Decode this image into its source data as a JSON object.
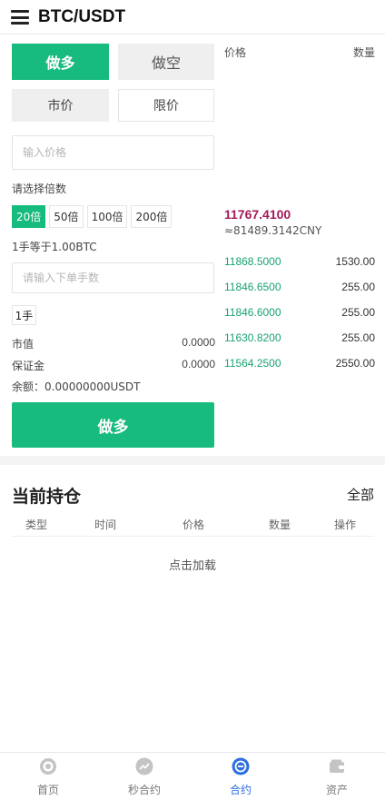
{
  "header": {
    "title": "BTC/USDT",
    "menu_icon": "hamburger-menu-icon"
  },
  "trade": {
    "long_tab": "做多",
    "short_tab": "做空",
    "market_tab": "市价",
    "limit_tab": "限价",
    "price_placeholder": "输入价格",
    "leverage_label": "请选择倍数",
    "leverages": [
      "20倍",
      "50倍",
      "100倍",
      "200倍"
    ],
    "leverage_selected": "20倍",
    "hand_info": "1手等于1.00BTC",
    "qty_placeholder": "请输入下单手数",
    "hand_unit": "1手",
    "market_value_label": "市值",
    "market_value": "0.0000",
    "margin_label": "保证金",
    "margin_value": "0.0000",
    "balance": "余额：0.00000000USDT",
    "submit_label": "做多"
  },
  "orderbook": {
    "price_header": "价格",
    "qty_header": "数量",
    "last_price": "11767.4100",
    "last_price_cny": "≈81489.3142CNY",
    "rows": [
      {
        "price": "11868.5000",
        "qty": "1530.00"
      },
      {
        "price": "11846.6500",
        "qty": "255.00"
      },
      {
        "price": "11846.6000",
        "qty": "255.00"
      },
      {
        "price": "11630.8200",
        "qty": "255.00"
      },
      {
        "price": "11564.2500",
        "qty": "2550.00"
      }
    ]
  },
  "positions": {
    "title": "当前持仓",
    "all_label": "全部",
    "columns": [
      "类型",
      "时间",
      "价格",
      "数量",
      "操作"
    ],
    "empty_text": "点击加载"
  },
  "footer": {
    "items": [
      {
        "label": "首页",
        "icon": "home-icon"
      },
      {
        "label": "秒合约",
        "icon": "second-contract-icon"
      },
      {
        "label": "合约",
        "icon": "contract-icon"
      },
      {
        "label": "资产",
        "icon": "wallet-icon"
      }
    ],
    "active": "合约"
  },
  "colors": {
    "accent": "#17bb7e",
    "last_price": "#a3195b",
    "nav_active": "#2f6fe0",
    "bid_price": "#17a36f"
  }
}
